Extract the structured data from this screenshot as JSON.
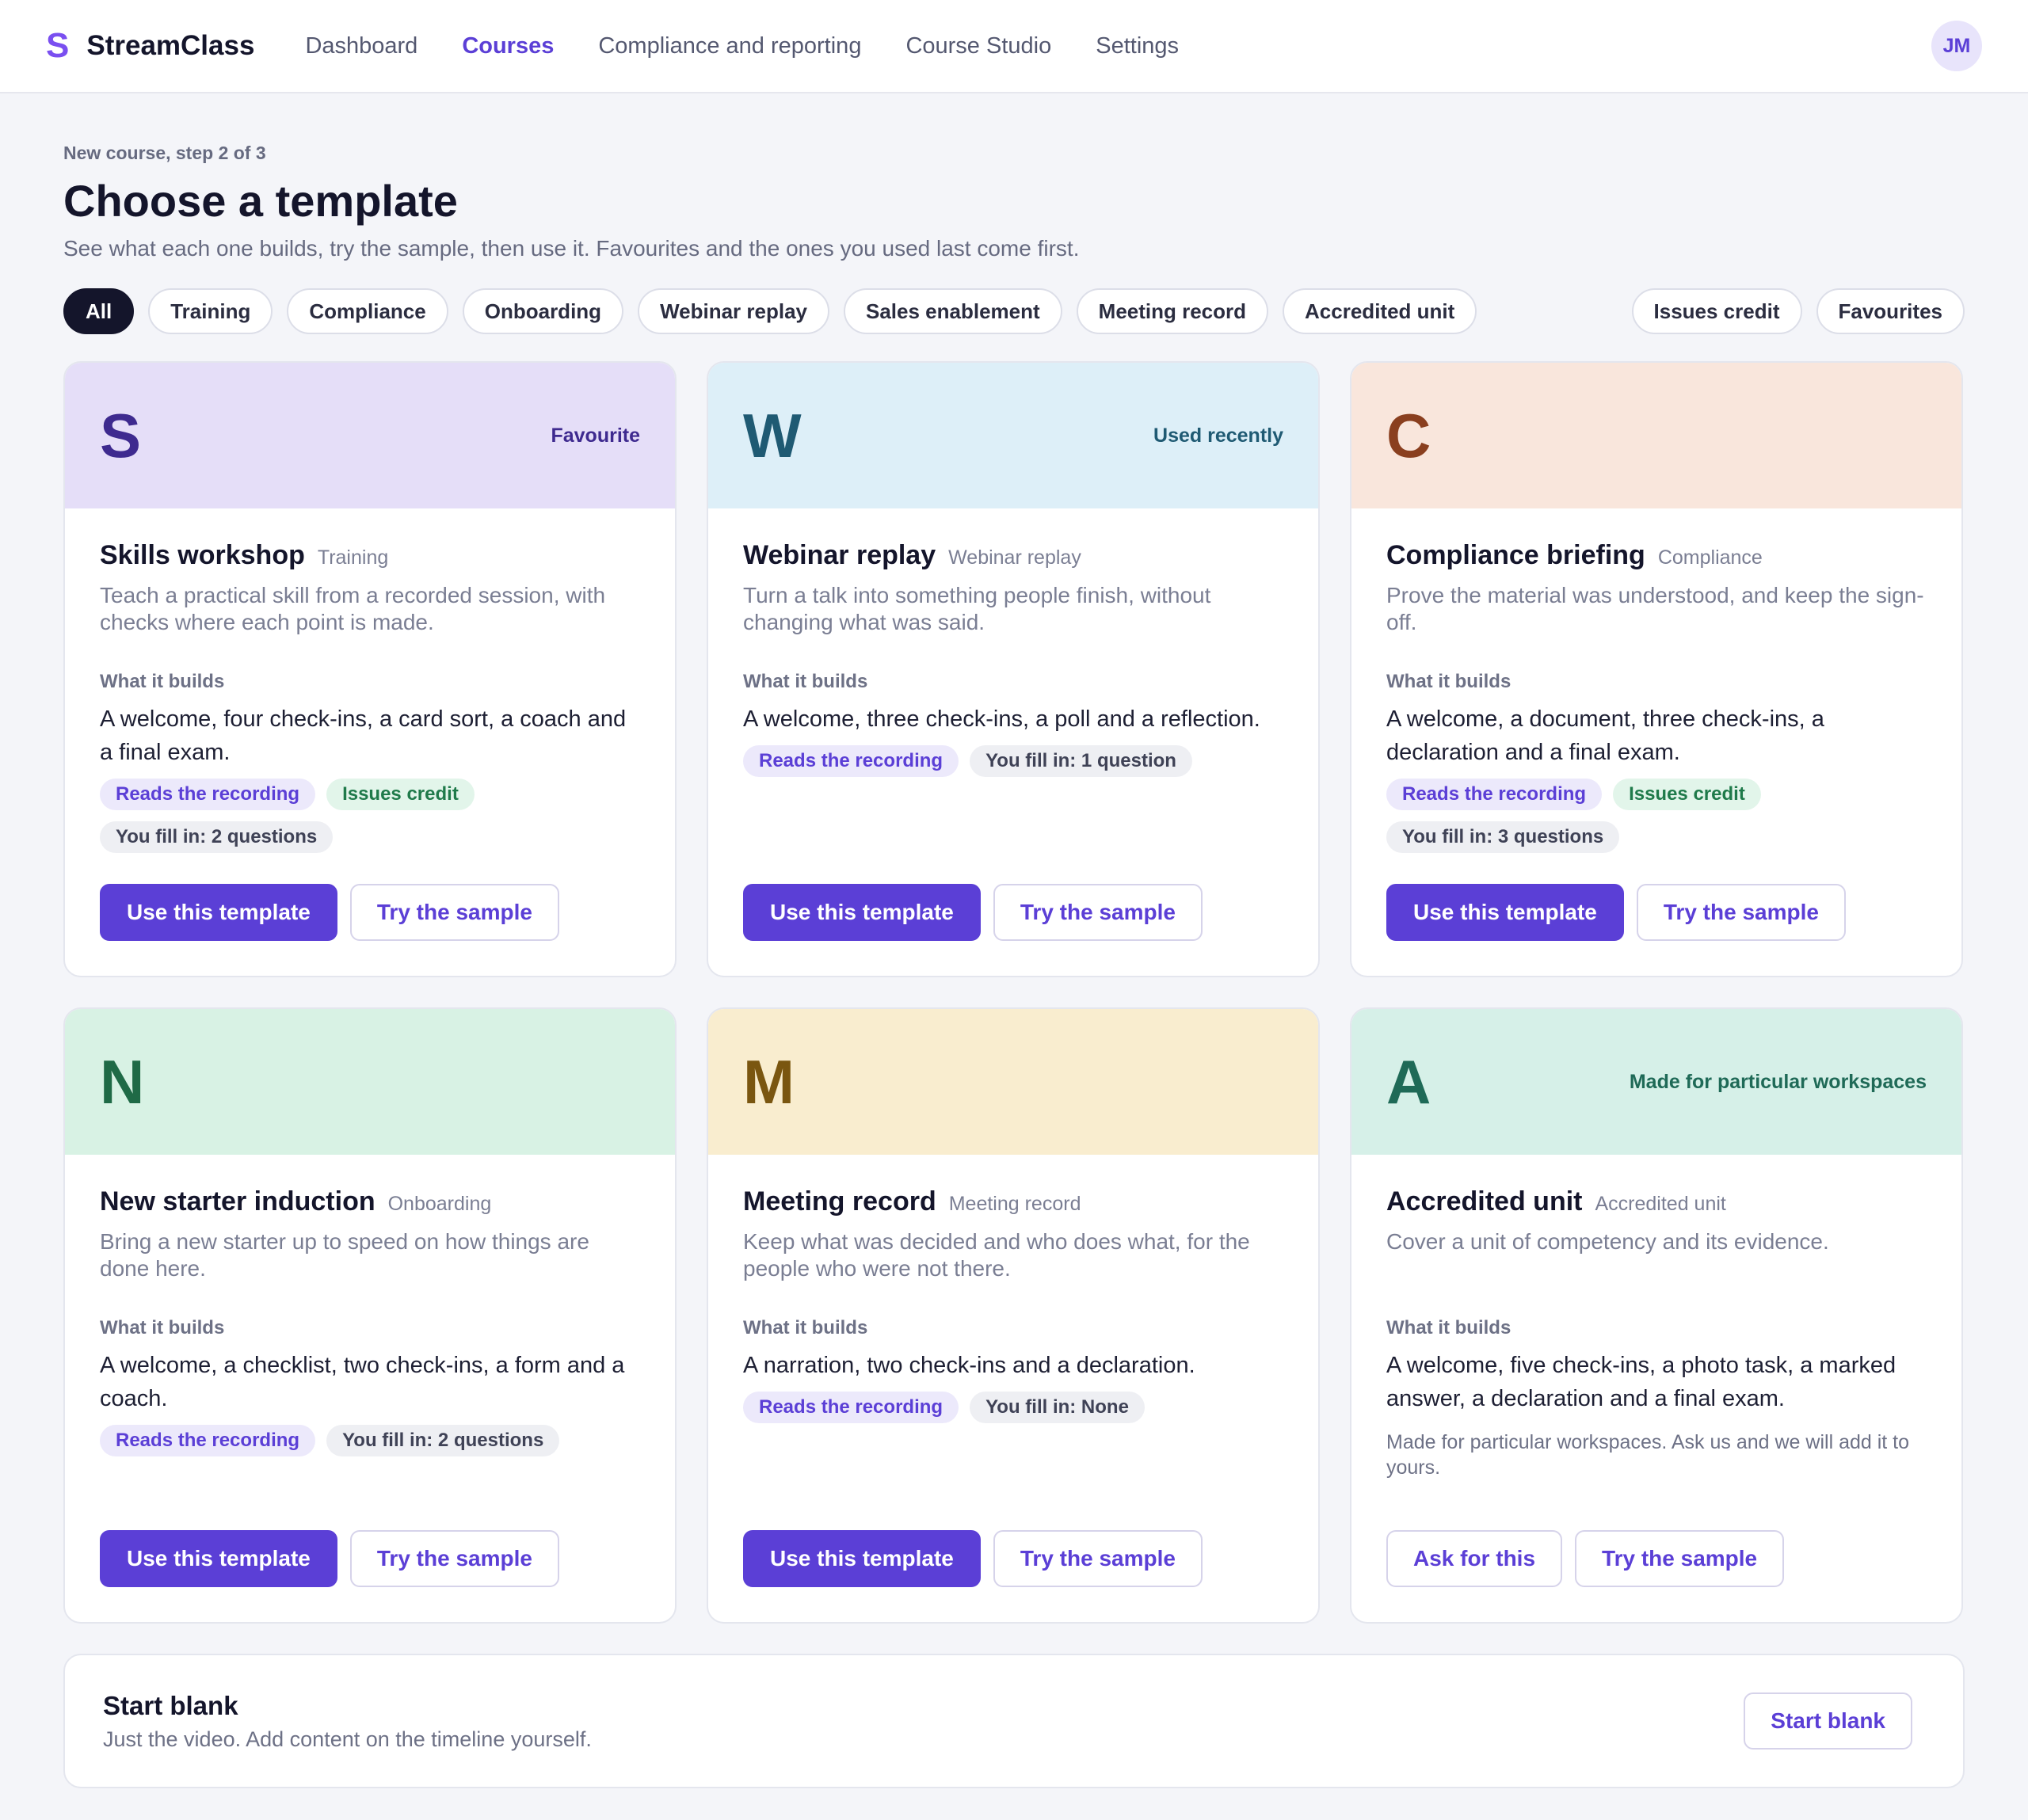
{
  "app": {
    "brand_mark": "S",
    "brand_name": "StreamClass",
    "avatar_initials": "JM"
  },
  "nav": {
    "items": [
      "Dashboard",
      "Courses",
      "Compliance and reporting",
      "Course Studio",
      "Settings"
    ],
    "active": "Courses"
  },
  "page": {
    "step": "New course, step 2 of 3",
    "title": "Choose a template",
    "subtitle": "See what each one builds, try the sample, then use it. Favourites and the ones you used last come first."
  },
  "filters": {
    "left": [
      "All",
      "Training",
      "Compliance",
      "Onboarding",
      "Webinar replay",
      "Sales enablement",
      "Meeting record",
      "Accredited unit"
    ],
    "right": [
      "Issues credit",
      "Favourites"
    ],
    "active": "All"
  },
  "builds_label": "What it builds",
  "buttons": {
    "use": "Use this template",
    "try": "Try the sample",
    "ask": "Ask for this"
  },
  "colors": {
    "accent": "#5b3fd6",
    "brand": "#7a4ff0",
    "card_heads": [
      "#e5def8",
      "#ddeff8",
      "#f9e6dc",
      "#d8f2e4",
      "#f9edcf",
      "#d6f0e8"
    ],
    "letters": [
      "#3e2a8f",
      "#1f5a73",
      "#8a3f1f",
      "#1f6a46",
      "#7a5610",
      "#1f6a57"
    ]
  },
  "templates": [
    {
      "letter": "S",
      "flag": "Favourite",
      "title": "Skills workshop",
      "tag": "Training",
      "description": "Teach a practical skill from a recorded session, with checks where each point is made.",
      "builds": "A welcome, four check-ins, a card sort, a coach and a final exam.",
      "badges": [
        {
          "label": "Reads the recording",
          "tone": "purple"
        },
        {
          "label": "Issues credit",
          "tone": "green"
        },
        {
          "label": "You fill in: 2 questions",
          "tone": "grey"
        }
      ]
    },
    {
      "letter": "W",
      "flag": "Used recently",
      "title": "Webinar replay",
      "tag": "Webinar replay",
      "description": "Turn a talk into something people finish, without changing what was said.",
      "builds": "A welcome, three check-ins, a poll and a reflection.",
      "badges": [
        {
          "label": "Reads the recording",
          "tone": "purple"
        },
        {
          "label": "You fill in: 1 question",
          "tone": "grey"
        }
      ]
    },
    {
      "letter": "C",
      "flag": "",
      "title": "Compliance briefing",
      "tag": "Compliance",
      "description": "Prove the material was understood, and keep the sign-off.",
      "builds": "A welcome, a document, three check-ins, a declaration and a final exam.",
      "badges": [
        {
          "label": "Reads the recording",
          "tone": "purple"
        },
        {
          "label": "Issues credit",
          "tone": "green"
        },
        {
          "label": "You fill in: 3 questions",
          "tone": "grey"
        }
      ]
    },
    {
      "letter": "N",
      "flag": "",
      "title": "New starter induction",
      "tag": "Onboarding",
      "description": "Bring a new starter up to speed on how things are done here.",
      "builds": "A welcome, a checklist, two check-ins, a form and a coach.",
      "badges": [
        {
          "label": "Reads the recording",
          "tone": "purple"
        },
        {
          "label": "You fill in: 2 questions",
          "tone": "grey"
        }
      ]
    },
    {
      "letter": "M",
      "flag": "",
      "title": "Meeting record",
      "tag": "Meeting record",
      "description": "Keep what was decided and who does what, for the people who were not there.",
      "builds": "A narration, two check-ins and a declaration.",
      "badges": [
        {
          "label": "Reads the recording",
          "tone": "purple"
        },
        {
          "label": "You fill in: None",
          "tone": "grey"
        }
      ]
    },
    {
      "letter": "A",
      "flag": "Made for particular workspaces",
      "title": "Accredited unit",
      "tag": "Accredited unit",
      "description": "Cover a unit of competency and its evidence.",
      "builds": "A welcome, five check-ins, a photo task, a marked answer, a declaration and a final exam.",
      "note": "Made for particular workspaces. Ask us and we will add it to yours.",
      "badges": []
    }
  ],
  "blank": {
    "title": "Start blank",
    "description": "Just the video. Add content on the timeline yourself.",
    "button": "Start blank"
  }
}
